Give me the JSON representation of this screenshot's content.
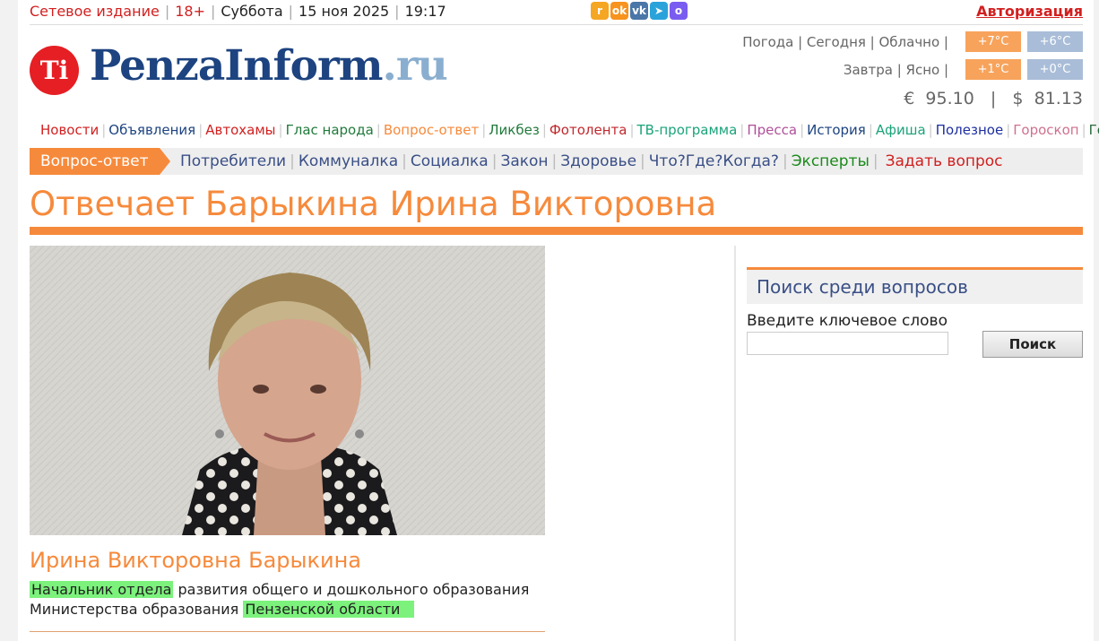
{
  "topbar": {
    "edition": "Сетевое издание",
    "age": "18+",
    "day": "Суббота",
    "date": "15 ноя 2025",
    "time": "19:17",
    "auth": "Авторизация",
    "social": [
      {
        "name": "rss-icon",
        "color": "#f5a623",
        "glyph": "r"
      },
      {
        "name": "odnoklassniki-icon",
        "color": "#f7931e",
        "glyph": "ok"
      },
      {
        "name": "vk-icon",
        "color": "#4a76a8",
        "glyph": "vk"
      },
      {
        "name": "telegram-icon",
        "color": "#2aa3db",
        "glyph": "➤"
      },
      {
        "name": "max-icon",
        "color": "#7a5cf0",
        "glyph": "o"
      }
    ]
  },
  "logo": {
    "mark": "Ti",
    "name": "PenzaInform",
    "tld": ".ru"
  },
  "weather": {
    "today_label": "Погода | Сегодня | Облачно |",
    "today_day": "+7°C",
    "today_night": "+6°C",
    "tomorrow_label": "Завтра | Ясно |",
    "tomorrow_day": "+1°C",
    "tomorrow_night": "+0°C",
    "rates": "€  95.10   |   $  81.13"
  },
  "mainnav": [
    {
      "label": "Новости",
      "color": "#d21f1f"
    },
    {
      "label": "Объявления",
      "color": "#1d4380"
    },
    {
      "label": "Автохамы",
      "color": "#d21f1f"
    },
    {
      "label": "Глас народа",
      "color": "#1f7a3a"
    },
    {
      "label": "Вопрос-ответ",
      "color": "#f68a3c"
    },
    {
      "label": "Ликбез",
      "color": "#1f7a3a"
    },
    {
      "label": "Фотолента",
      "color": "#c0282d"
    },
    {
      "label": "ТВ-программа",
      "color": "#1aa37a"
    },
    {
      "label": "Пресса",
      "color": "#b0509a"
    },
    {
      "label": "История",
      "color": "#1d4380"
    },
    {
      "label": "Афиша",
      "color": "#1aa37a"
    },
    {
      "label": "Полезное",
      "color": "#1d2fa0"
    },
    {
      "label": "Гороскоп",
      "color": "#d0708c"
    },
    {
      "label": "Гостевая",
      "color": "#2a6a3a"
    }
  ],
  "subnav": {
    "active": "Вопрос-ответ",
    "items": [
      {
        "label": "Потребители",
        "color": "#3a4f86"
      },
      {
        "label": "Коммуналка",
        "color": "#3a4f86"
      },
      {
        "label": "Социалка",
        "color": "#3a4f86"
      },
      {
        "label": "Закон",
        "color": "#3a4f86"
      },
      {
        "label": "Здоровье",
        "color": "#3a4f86"
      },
      {
        "label": "Что?Где?Когда?",
        "color": "#3a4f86"
      },
      {
        "label": "Эксперты",
        "color": "#1a8a1a"
      }
    ],
    "ask": "Задать вопрос"
  },
  "page": {
    "title": "Отвечает Барыкина Ирина Викторовна",
    "name": "Ирина Викторовна Барыкина",
    "pos_hl1": "Начальник отдела",
    "pos_mid": " развития общего и дошкольного образования Министерства образования ",
    "pos_hl2": "Пензенской области"
  },
  "search": {
    "heading": "Поиск среди вопросов",
    "label": "Введите ключевое слово",
    "input_value": "",
    "button": "Поиск"
  },
  "colors": {
    "accent": "#f68a3c",
    "brand": "#1d4380",
    "red": "#d21f1f"
  }
}
